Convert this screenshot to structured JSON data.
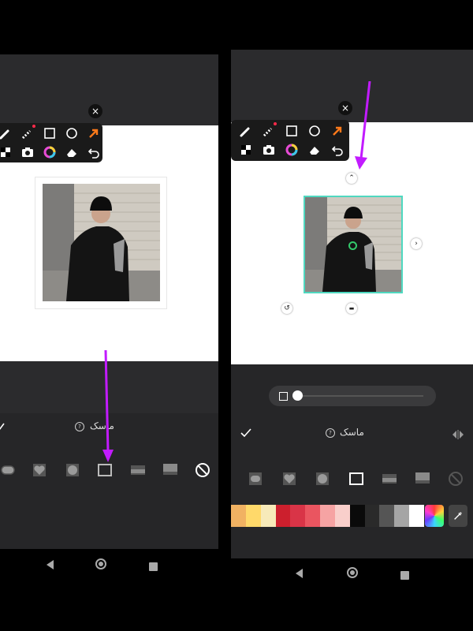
{
  "left_panel": {
    "mask_label": "ماسک",
    "help_symbol": "?",
    "close_symbol": "×",
    "tools": [
      "brush-icon",
      "eraser-brush-icon",
      "square-icon",
      "circle-icon",
      "arrow-icon",
      "checker-icon",
      "camera-icon",
      "color-wheel-icon",
      "eraser-icon",
      "undo-icon"
    ],
    "shapes": [
      "rounded-rect-shape",
      "heart-shape",
      "circle-shape",
      "square-frame-shape",
      "bar-shape",
      "box-shape",
      "none-shape"
    ]
  },
  "right_panel": {
    "mask_label": "ماسک",
    "help_symbol": "?",
    "close_symbol": "×",
    "tools": [
      "brush-icon",
      "eraser-brush-icon",
      "square-icon",
      "circle-icon",
      "arrow-icon",
      "checker-icon",
      "camera-icon",
      "color-wheel-icon",
      "eraser-icon",
      "undo-icon"
    ],
    "shapes": [
      "rounded-rect-shape",
      "heart-shape",
      "circle-shape",
      "square-frame-shape",
      "bar-shape",
      "box-shape",
      "none-shape"
    ],
    "slider_level": 0.0,
    "palette": [
      "#f1b262",
      "#ffd96a",
      "#f7eab9",
      "#cc1f2d",
      "#d93447",
      "#ea5560",
      "#f6a3a3",
      "#f9cfcb",
      "#0a0a0a",
      "#2a2a2a",
      "#555555",
      "#a5a5a5",
      "#ffffff"
    ]
  },
  "colors": {
    "annotation_arrow": "#c21bff",
    "selection_frame": "#4fd8c0",
    "accent_orange": "#ff7a1a"
  }
}
